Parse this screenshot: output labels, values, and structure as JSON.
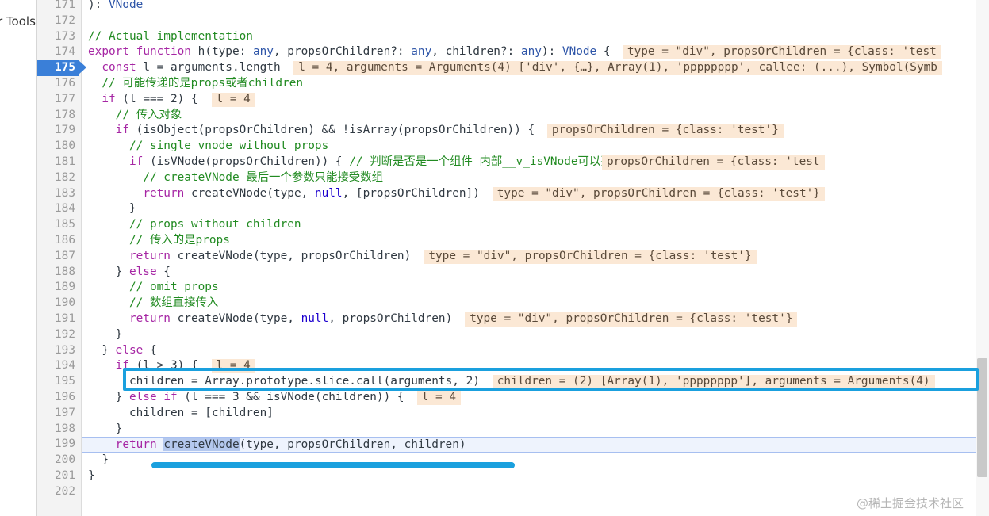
{
  "left_panel": {
    "label": "r Tools"
  },
  "lines": [
    {
      "n": "171",
      "code": "): VNode"
    },
    {
      "n": "172",
      "code": ""
    },
    {
      "n": "173",
      "code": "// Actual implementation"
    },
    {
      "n": "174",
      "code": "export function h(type: any, propsOrChildren?: any, children?: any): VNode {",
      "val": "type = \"div\", propsOrChildren = {class: 'test"
    },
    {
      "n": "175",
      "code": "  const l = arguments.length",
      "val": "l = 4, arguments = Arguments(4) ['div', {…}, Array(1), 'pppppppp', callee: (...), Symbol(Symb",
      "active": true
    },
    {
      "n": "176",
      "code": "  // 可能传递的是props或者children"
    },
    {
      "n": "177",
      "code": "  if (l === 2) {",
      "val": "l = 4"
    },
    {
      "n": "178",
      "code": "    // 传入对象"
    },
    {
      "n": "179",
      "code": "    if (isObject(propsOrChildren) && !isArray(propsOrChildren)) {",
      "val": "propsOrChildren = {class: 'test'}"
    },
    {
      "n": "180",
      "code": "      // single vnode without props"
    },
    {
      "n": "181",
      "code": "      if (isVNode(propsOrChildren)) { // 判断是否是一个组件 内部__v_isVNode可以判断是否是组件",
      "val": "propsOrChildren = {class: 'test"
    },
    {
      "n": "182",
      "code": "        // createVNode 最后一个参数只能接受数组"
    },
    {
      "n": "183",
      "code": "        return createVNode(type, null, [propsOrChildren])",
      "val": "type = \"div\", propsOrChildren = {class: 'test'}"
    },
    {
      "n": "184",
      "code": "      }"
    },
    {
      "n": "185",
      "code": "      // props without children"
    },
    {
      "n": "186",
      "code": "      // 传入的是props"
    },
    {
      "n": "187",
      "code": "      return createVNode(type, propsOrChildren)",
      "val": "type = \"div\", propsOrChildren = {class: 'test'}"
    },
    {
      "n": "188",
      "code": "    } else {"
    },
    {
      "n": "189",
      "code": "      // omit props"
    },
    {
      "n": "190",
      "code": "      // 数组直接传入"
    },
    {
      "n": "191",
      "code": "      return createVNode(type, null, propsOrChildren)",
      "val": "type = \"div\", propsOrChildren = {class: 'test'}"
    },
    {
      "n": "192",
      "code": "    }"
    },
    {
      "n": "193",
      "code": "  } else {"
    },
    {
      "n": "194",
      "code": "    if (l > 3) {",
      "val": "l = 4"
    },
    {
      "n": "195",
      "code": "      children = Array.prototype.slice.call(arguments, 2)",
      "val": "children = (2) [Array(1), 'pppppppp'], arguments = Arguments(4)"
    },
    {
      "n": "196",
      "code": "    } else if (l === 3 && isVNode(children)) {",
      "val": "l = 4"
    },
    {
      "n": "197",
      "code": "      children = [children]"
    },
    {
      "n": "198",
      "code": "    }"
    },
    {
      "n": "199",
      "code": "    return createVNode(type, propsOrChildren, children)",
      "current": true
    },
    {
      "n": "200",
      "code": "  }"
    },
    {
      "n": "201",
      "code": "}"
    },
    {
      "n": "202",
      "code": ""
    }
  ],
  "selected_token": "createVNode",
  "watermark": "@稀土掘金技术社区",
  "colors": {
    "inline_value_bg": "#fbe8d5",
    "highlight_box": "#1aa0de",
    "active_line_number_bg": "#3a7fd8",
    "current_line_bg": "#eef3fd"
  }
}
